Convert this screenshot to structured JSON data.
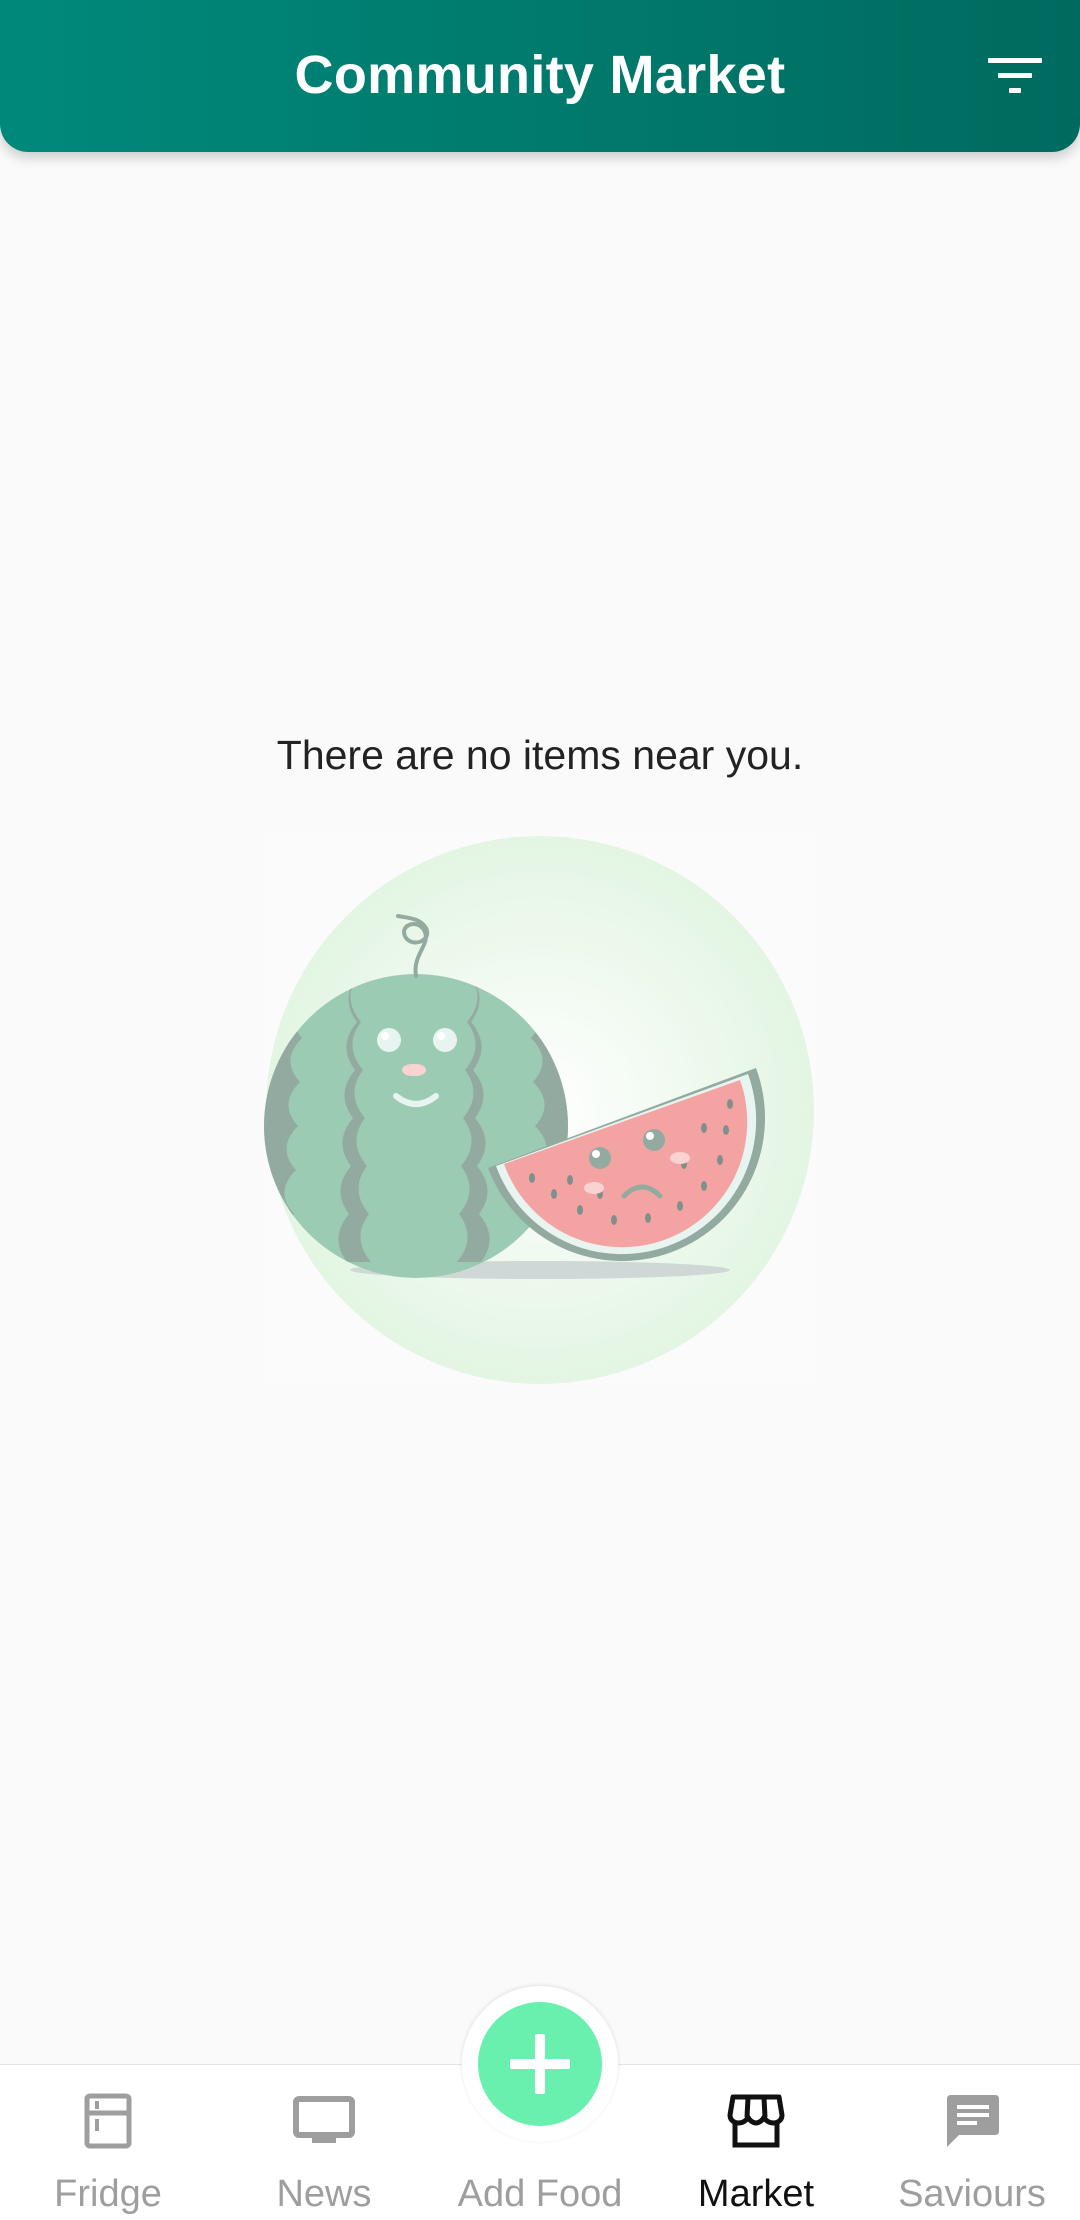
{
  "header": {
    "title": "Community Market",
    "filter_icon": "filter-list-icon"
  },
  "empty_state": {
    "message": "There are no items near you.",
    "illustration": "sad-watermelon-illustration"
  },
  "bottom_nav": {
    "active": "Market",
    "items": [
      {
        "label": "Fridge",
        "icon": "fridge-icon"
      },
      {
        "label": "News",
        "icon": "monitor-icon"
      },
      {
        "label": "Add Food",
        "icon": "add-circle-icon"
      },
      {
        "label": "Market",
        "icon": "storefront-icon"
      },
      {
        "label": "Saviours",
        "icon": "chat-icon"
      }
    ]
  },
  "colors": {
    "header": "#00897b",
    "fab": "#69f0ae",
    "inactive_nav": "#9e9e9e",
    "active_nav": "#111111"
  }
}
